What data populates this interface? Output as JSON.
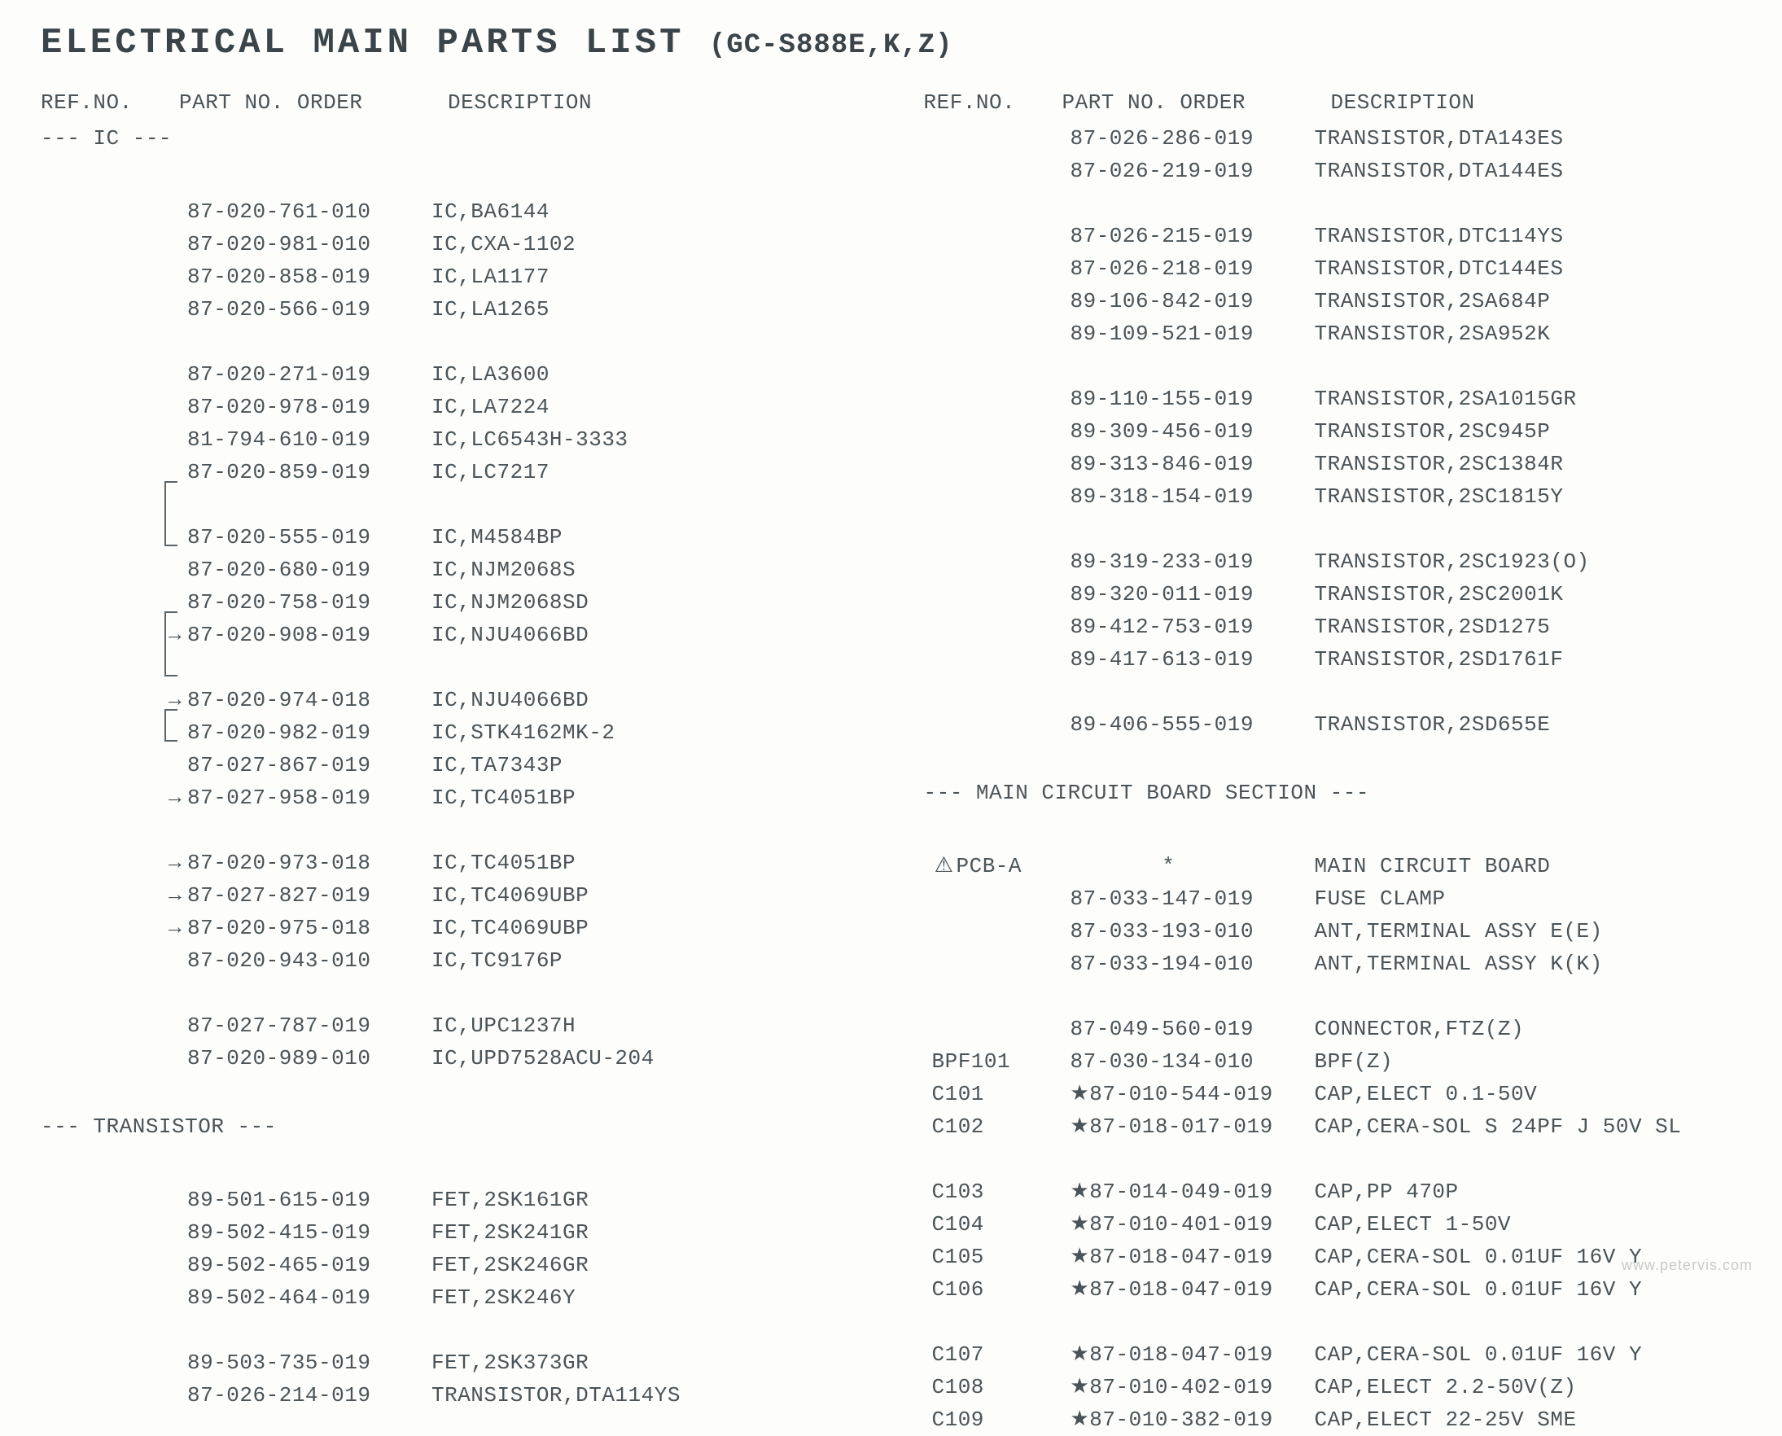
{
  "title_main": "ELECTRICAL MAIN PARTS LIST",
  "title_sub": "(GC-S888E,K,Z)",
  "headers": {
    "ref": "REF.NO.",
    "pn": "PART NO. ORDER",
    "desc": "DESCRIPTION"
  },
  "section_ic": "--- IC ---",
  "section_tr": "--- TRANSISTOR ---",
  "section_main": "--- MAIN CIRCUIT BOARD SECTION ---",
  "watermark": "www.petervis.com",
  "left": [
    {
      "t": "sec",
      "v": "section_ic"
    },
    {
      "t": "sp"
    },
    {
      "ref": "",
      "pn": "87-020-761-010",
      "desc": "IC,BA6144"
    },
    {
      "ref": "",
      "pn": "87-020-981-010",
      "desc": "IC,CXA-1102"
    },
    {
      "ref": "",
      "pn": "87-020-858-019",
      "desc": "IC,LA1177"
    },
    {
      "ref": "",
      "pn": "87-020-566-019",
      "desc": "IC,LA1265"
    },
    {
      "t": "sp"
    },
    {
      "ref": "",
      "pn": "87-020-271-019",
      "desc": "IC,LA3600"
    },
    {
      "ref": "",
      "pn": "87-020-978-019",
      "desc": "IC,LA7224"
    },
    {
      "ref": "",
      "pn": "81-794-610-019",
      "desc": "IC,LC6543H-3333"
    },
    {
      "ref": "",
      "pn": "87-020-859-019",
      "desc": "IC,LC7217"
    },
    {
      "t": "sp"
    },
    {
      "ref": "",
      "pn": "87-020-555-019",
      "desc": "IC,M4584BP"
    },
    {
      "ref": "",
      "pn": "87-020-680-019",
      "desc": "IC,NJM2068S"
    },
    {
      "ref": "",
      "pn": "87-020-758-019",
      "desc": "IC,NJM2068SD"
    },
    {
      "ref": "",
      "pn": "87-020-908-019",
      "desc": "IC,NJU4066BD",
      "mark": "→"
    },
    {
      "t": "sp"
    },
    {
      "ref": "",
      "pn": "87-020-974-018",
      "desc": "IC,NJU4066BD",
      "mark": "→"
    },
    {
      "ref": "",
      "pn": "87-020-982-019",
      "desc": "IC,STK4162MK-2"
    },
    {
      "ref": "",
      "pn": "87-027-867-019",
      "desc": "IC,TA7343P"
    },
    {
      "ref": "",
      "pn": "87-027-958-019",
      "desc": "IC,TC4051BP",
      "mark": "→"
    },
    {
      "t": "sp"
    },
    {
      "ref": "",
      "pn": "87-020-973-018",
      "desc": "IC,TC4051BP",
      "mark": "→"
    },
    {
      "ref": "",
      "pn": "87-027-827-019",
      "desc": "IC,TC4069UBP",
      "mark": "→"
    },
    {
      "ref": "",
      "pn": "87-020-975-018",
      "desc": "IC,TC4069UBP",
      "mark": "→"
    },
    {
      "ref": "",
      "pn": "87-020-943-010",
      "desc": "IC,TC9176P"
    },
    {
      "t": "sp"
    },
    {
      "ref": "",
      "pn": "87-027-787-019",
      "desc": "IC,UPC1237H"
    },
    {
      "ref": "",
      "pn": "87-020-989-010",
      "desc": "IC,UPD7528ACU-204"
    },
    {
      "t": "sp"
    },
    {
      "t": "sec",
      "v": "section_tr"
    },
    {
      "t": "sp"
    },
    {
      "ref": "",
      "pn": "89-501-615-019",
      "desc": "FET,2SK161GR"
    },
    {
      "ref": "",
      "pn": "89-502-415-019",
      "desc": "FET,2SK241GR"
    },
    {
      "ref": "",
      "pn": "89-502-465-019",
      "desc": "FET,2SK246GR"
    },
    {
      "ref": "",
      "pn": "89-502-464-019",
      "desc": "FET,2SK246Y"
    },
    {
      "t": "sp"
    },
    {
      "ref": "",
      "pn": "89-503-735-019",
      "desc": "FET,2SK373GR"
    },
    {
      "ref": "",
      "pn": "87-026-214-019",
      "desc": "TRANSISTOR,DTA114YS"
    }
  ],
  "right": [
    {
      "ref": "",
      "pn": "87-026-286-019",
      "desc": "TRANSISTOR,DTA143ES"
    },
    {
      "ref": "",
      "pn": "87-026-219-019",
      "desc": "TRANSISTOR,DTA144ES"
    },
    {
      "t": "sp"
    },
    {
      "ref": "",
      "pn": "87-026-215-019",
      "desc": "TRANSISTOR,DTC114YS"
    },
    {
      "ref": "",
      "pn": "87-026-218-019",
      "desc": "TRANSISTOR,DTC144ES"
    },
    {
      "ref": "",
      "pn": "89-106-842-019",
      "desc": "TRANSISTOR,2SA684P"
    },
    {
      "ref": "",
      "pn": "89-109-521-019",
      "desc": "TRANSISTOR,2SA952K"
    },
    {
      "t": "sp"
    },
    {
      "ref": "",
      "pn": "89-110-155-019",
      "desc": "TRANSISTOR,2SA1015GR"
    },
    {
      "ref": "",
      "pn": "89-309-456-019",
      "desc": "TRANSISTOR,2SC945P"
    },
    {
      "ref": "",
      "pn": "89-313-846-019",
      "desc": "TRANSISTOR,2SC1384R"
    },
    {
      "ref": "",
      "pn": "89-318-154-019",
      "desc": "TRANSISTOR,2SC1815Y"
    },
    {
      "t": "sp"
    },
    {
      "ref": "",
      "pn": "89-319-233-019",
      "desc": "TRANSISTOR,2SC1923(O)"
    },
    {
      "ref": "",
      "pn": "89-320-011-019",
      "desc": "TRANSISTOR,2SC2001K"
    },
    {
      "ref": "",
      "pn": "89-412-753-019",
      "desc": "TRANSISTOR,2SD1275"
    },
    {
      "ref": "",
      "pn": "89-417-613-019",
      "desc": "TRANSISTOR,2SD1761F"
    },
    {
      "t": "sp"
    },
    {
      "ref": "",
      "pn": "89-406-555-019",
      "desc": "TRANSISTOR,2SD655E"
    },
    {
      "t": "sp"
    },
    {
      "t": "sec",
      "v": "section_main"
    },
    {
      "t": "sp"
    },
    {
      "ref": "PCB-A",
      "pn": "       *",
      "desc": "MAIN CIRCUIT BOARD",
      "warn": true
    },
    {
      "ref": "",
      "pn": "87-033-147-019",
      "desc": "FUSE CLAMP"
    },
    {
      "ref": "",
      "pn": "87-033-193-010",
      "desc": "ANT,TERMINAL ASSY E(E)"
    },
    {
      "ref": "",
      "pn": "87-033-194-010",
      "desc": "ANT,TERMINAL ASSY K(K)"
    },
    {
      "t": "sp"
    },
    {
      "ref": "",
      "pn": "87-049-560-019",
      "desc": "CONNECTOR,FTZ(Z)"
    },
    {
      "ref": "BPF101",
      "pn": "87-030-134-010",
      "desc": "BPF(Z)"
    },
    {
      "ref": "C101",
      "pn": "87-010-544-019",
      "desc": "CAP,ELECT 0.1-50V",
      "star": true
    },
    {
      "ref": "C102",
      "pn": "87-018-017-019",
      "desc": "CAP,CERA-SOL S 24PF J 50V SL",
      "star": true
    },
    {
      "t": "sp"
    },
    {
      "ref": "C103",
      "pn": "87-014-049-019",
      "desc": "CAP,PP 470P",
      "star": true
    },
    {
      "ref": "C104",
      "pn": "87-010-401-019",
      "desc": "CAP,ELECT 1-50V",
      "star": true
    },
    {
      "ref": "C105",
      "pn": "87-018-047-019",
      "desc": "CAP,CERA-SOL 0.01UF 16V Y",
      "star": true
    },
    {
      "ref": "C106",
      "pn": "87-018-047-019",
      "desc": "CAP,CERA-SOL 0.01UF 16V Y",
      "star": true
    },
    {
      "t": "sp"
    },
    {
      "ref": "C107",
      "pn": "87-018-047-019",
      "desc": "CAP,CERA-SOL 0.01UF 16V Y",
      "star": true
    },
    {
      "ref": "C108",
      "pn": "87-010-402-019",
      "desc": "CAP,ELECT 2.2-50V(Z)",
      "star": true
    },
    {
      "ref": "C109",
      "pn": "87-010-382-019",
      "desc": "CAP,ELECT 22-25V SME",
      "star": true
    }
  ]
}
